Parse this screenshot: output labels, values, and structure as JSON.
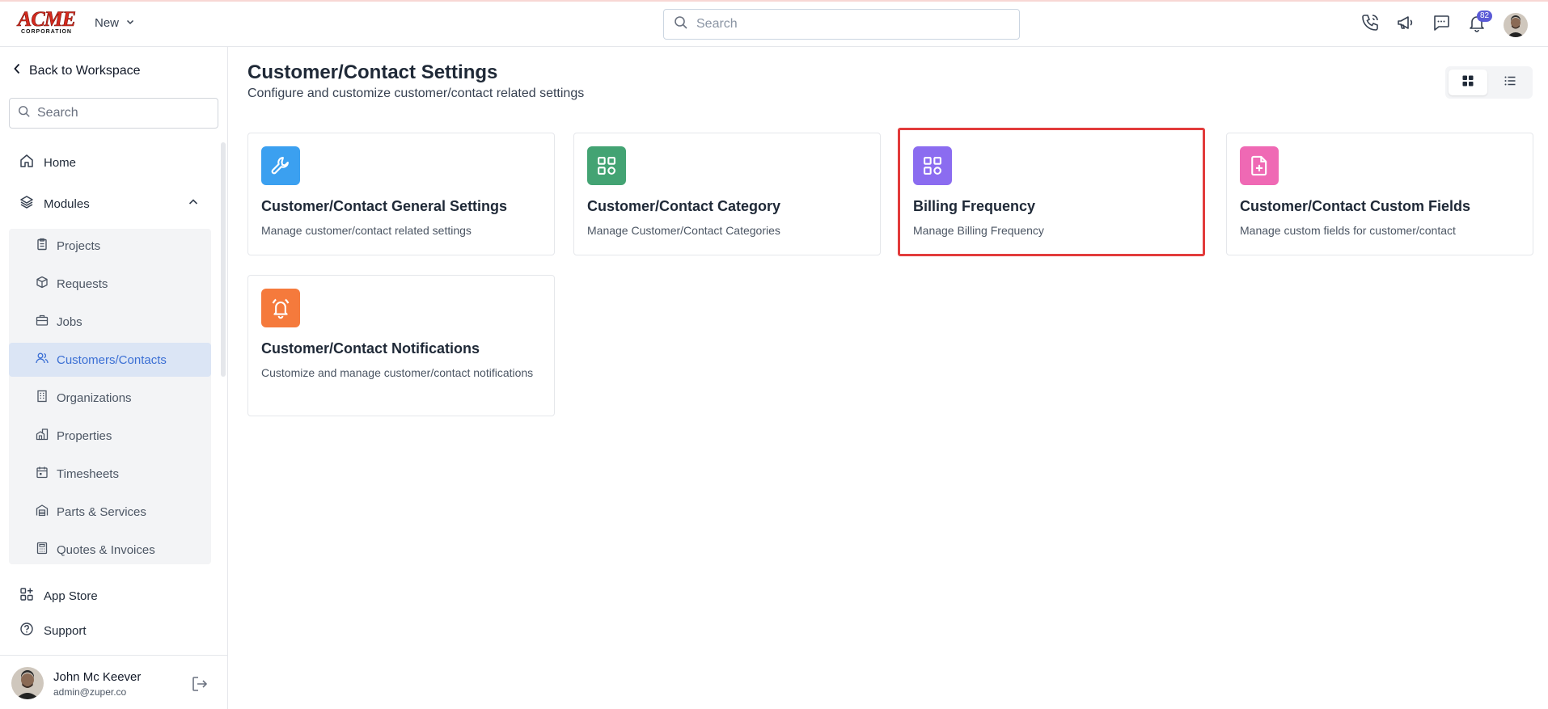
{
  "header": {
    "logo_text": "ACME",
    "logo_sub": "CORPORATION",
    "new_label": "New",
    "search_placeholder": "Search",
    "notification_count": "82",
    "icons": [
      "phone-icon",
      "megaphone-icon",
      "chat-icon",
      "bell-icon"
    ]
  },
  "sidebar": {
    "back_label": "Back to Workspace",
    "search_placeholder": "Search",
    "home_label": "Home",
    "modules_label": "Modules",
    "modules": [
      {
        "label": "Projects",
        "icon": "clipboard-icon"
      },
      {
        "label": "Requests",
        "icon": "box-icon"
      },
      {
        "label": "Jobs",
        "icon": "briefcase-icon"
      },
      {
        "label": "Customers/Contacts",
        "icon": "users-icon",
        "active": true
      },
      {
        "label": "Organizations",
        "icon": "building-icon"
      },
      {
        "label": "Properties",
        "icon": "property-icon"
      },
      {
        "label": "Timesheets",
        "icon": "calendar-icon"
      },
      {
        "label": "Parts & Services",
        "icon": "warehouse-icon"
      },
      {
        "label": "Quotes & Invoices",
        "icon": "calculator-icon"
      }
    ],
    "app_store_label": "App Store",
    "support_label": "Support",
    "user": {
      "name": "John Mc Keever",
      "email": "admin@zuper.co"
    }
  },
  "main": {
    "title": "Customer/Contact Settings",
    "subtitle": "Configure and customize customer/contact related settings",
    "cards": [
      {
        "title": "Customer/Contact General Settings",
        "desc": "Manage customer/contact related settings",
        "icon": "wrench-icon",
        "color": "#3ba0f0"
      },
      {
        "title": "Customer/Contact Category",
        "desc": "Manage Customer/Contact Categories",
        "icon": "grid-icon",
        "color": "#43a373"
      },
      {
        "title": "Billing Frequency",
        "desc": "Manage Billing Frequency",
        "icon": "grid-icon",
        "color": "#8b6cf0",
        "highlighted": true
      },
      {
        "title": "Customer/Contact Custom Fields",
        "desc": "Manage custom fields for customer/contact",
        "icon": "file-plus-icon",
        "color": "#ef69b4"
      },
      {
        "title": "Customer/Contact Notifications",
        "desc": "Customize and manage customer/contact notifications",
        "icon": "alarm-bell-icon",
        "color": "#f57a3c"
      }
    ]
  },
  "colors": {
    "accent": "#3b6fd4",
    "highlight": "#e23b3b"
  }
}
